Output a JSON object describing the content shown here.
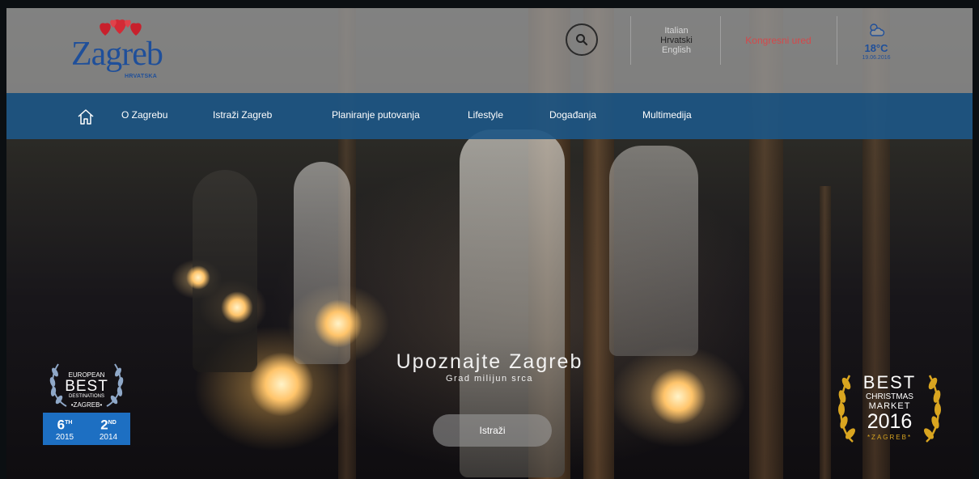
{
  "header": {
    "logo": {
      "title": "Zagreb",
      "subtitle": "HRVATSKA"
    },
    "languages": [
      {
        "label": "Italian",
        "active": false
      },
      {
        "label": "Hrvatski",
        "active": true
      },
      {
        "label": "English",
        "active": false
      }
    ],
    "congress_label": "Kongresni ured",
    "weather": {
      "icon": "cloud-sun-icon",
      "temp": "18°C",
      "date": "19.06.2016"
    }
  },
  "nav": {
    "home_icon": "home-icon",
    "items": [
      {
        "label": "O Zagrebu"
      },
      {
        "label": "Istraži Zagreb"
      },
      {
        "label": "Planiranje putovanja"
      },
      {
        "label": "Lifestyle"
      },
      {
        "label": "Događanja"
      },
      {
        "label": "Multimedija"
      }
    ]
  },
  "hero": {
    "title": "Upoznajte Zagreb",
    "subtitle": "Grad milijun srca",
    "cta_label": "Istraži"
  },
  "badges": {
    "european_best": {
      "line1": "EUROPEAN",
      "line2": "BEST",
      "line3": "DESTINATIONS",
      "city": "•ZAGREB•",
      "ranks": [
        {
          "num": "6",
          "sup": "TH",
          "year": "2015"
        },
        {
          "num": "2",
          "sup": "ND",
          "year": "2014"
        }
      ]
    },
    "christmas_market": {
      "line1": "BEST",
      "line2": "CHRISTMAS",
      "line3": "MARKET",
      "year": "2016",
      "city": "*ZAGREB*"
    }
  },
  "colors": {
    "brand_blue": "#1f4f9a",
    "nav_blue": "#1d5684",
    "congress_red": "#d4484a",
    "rank_blue": "#1d6fc2",
    "gold": "#d9a520"
  }
}
